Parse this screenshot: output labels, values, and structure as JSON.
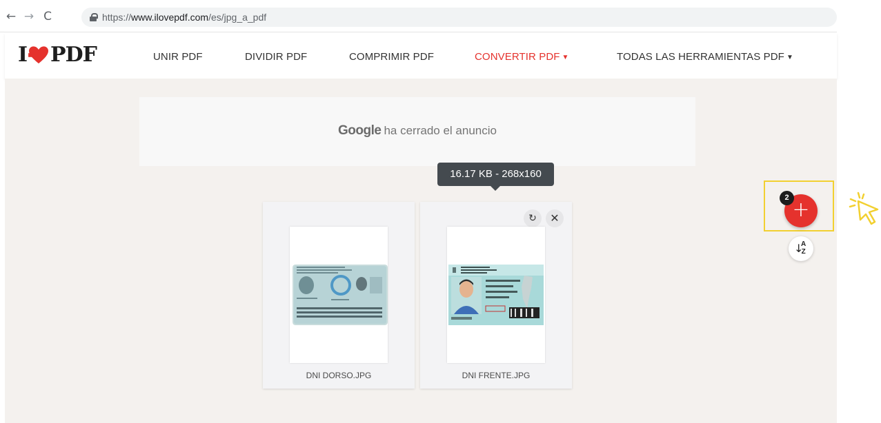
{
  "browser": {
    "url_scheme": "https://",
    "url_host": "www.ilovepdf.com",
    "url_path": "/es/jpg_a_pdf"
  },
  "header": {
    "logo_left": "I",
    "logo_right": "PDF",
    "nav": [
      {
        "label": "UNIR PDF"
      },
      {
        "label": "DIVIDIR PDF"
      },
      {
        "label": "COMPRIMIR PDF"
      },
      {
        "label": "CONVERTIR PDF",
        "caret": "▼",
        "active": true
      },
      {
        "label": "TODAS LAS HERRAMIENTAS PDF",
        "caret": "▼"
      }
    ]
  },
  "ad": {
    "brand": "Google",
    "message": "ha cerrado el anuncio"
  },
  "tooltip": "16.17 KB - 268x160",
  "files": [
    {
      "name": "DNI DORSO.JPG"
    },
    {
      "name": "DNI FRENTE.JPG"
    }
  ],
  "controls": {
    "file_count": "2",
    "add_symbol": "+",
    "sort_arrow": "↓",
    "sort_letters_top": "A",
    "sort_letters_bottom": "Z"
  },
  "colors": {
    "brand_red": "#e5322d",
    "highlight": "#f2d030",
    "workspace_bg": "#f4f1ee"
  },
  "icons": [
    "back-arrow-icon",
    "forward-arrow-icon",
    "reload-icon",
    "lock-icon",
    "heart-logo-icon",
    "rotate-icon",
    "close-icon",
    "plus-icon",
    "sort-az-icon",
    "cursor-click-icon"
  ]
}
